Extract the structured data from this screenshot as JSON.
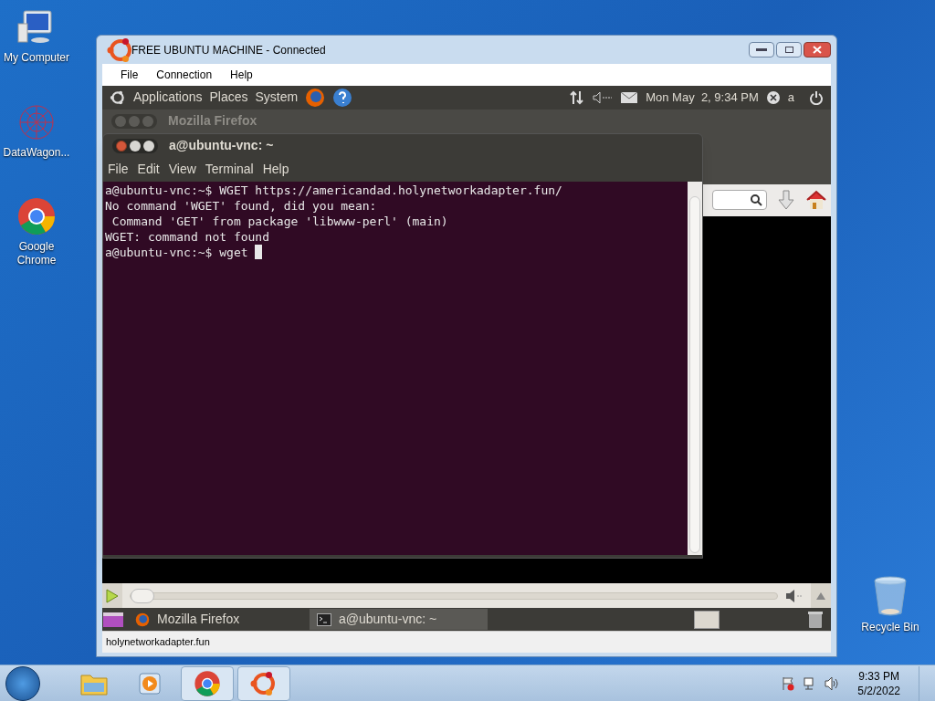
{
  "desktop_icons": [
    {
      "label": "My Computer",
      "kind": "computer"
    },
    {
      "label": "DataWagon...",
      "kind": "network"
    },
    {
      "label": "Google Chrome",
      "kind": "chrome"
    },
    {
      "label": "Recycle Bin",
      "kind": "recycle-bin"
    }
  ],
  "vnc_window": {
    "title": "FREE UBUNTU MACHINE - Connected",
    "menu": [
      "File",
      "Connection",
      "Help"
    ],
    "status": "holynetworkadapter.fun"
  },
  "remote": {
    "top_panel": {
      "menus": [
        "Applications",
        "Places",
        "System"
      ],
      "clock": "Mon May  2, 9:34 PM",
      "user": "a"
    },
    "firefox": {
      "title": "Mozilla Firefox"
    },
    "terminal": {
      "title": "a@ubuntu-vnc: ~",
      "menu": [
        "File",
        "Edit",
        "View",
        "Terminal",
        "Help"
      ],
      "lines": [
        "a@ubuntu-vnc:~$ WGET https://americandad.holynetworkadapter.fun/",
        "No command 'WGET' found, did you mean:",
        " Command 'GET' from package 'libwww-perl' (main)",
        "WGET: command not found",
        "a@ubuntu-vnc:~$ wget "
      ],
      "cursor": true
    },
    "media_bar": {
      "level": 0
    },
    "bottom_panel": {
      "tasks": [
        {
          "label": "Mozilla Firefox",
          "kind": "browser",
          "selected": false
        },
        {
          "label": "a@ubuntu-vnc: ~",
          "kind": "terminal",
          "selected": true
        }
      ]
    }
  },
  "taskbar": {
    "apps": [
      {
        "kind": "folder",
        "open": false
      },
      {
        "kind": "media",
        "open": false
      },
      {
        "kind": "chrome",
        "open": true
      },
      {
        "kind": "ubuntu",
        "open": true
      }
    ],
    "time": "9:33 PM",
    "date": "5/2/2022"
  }
}
